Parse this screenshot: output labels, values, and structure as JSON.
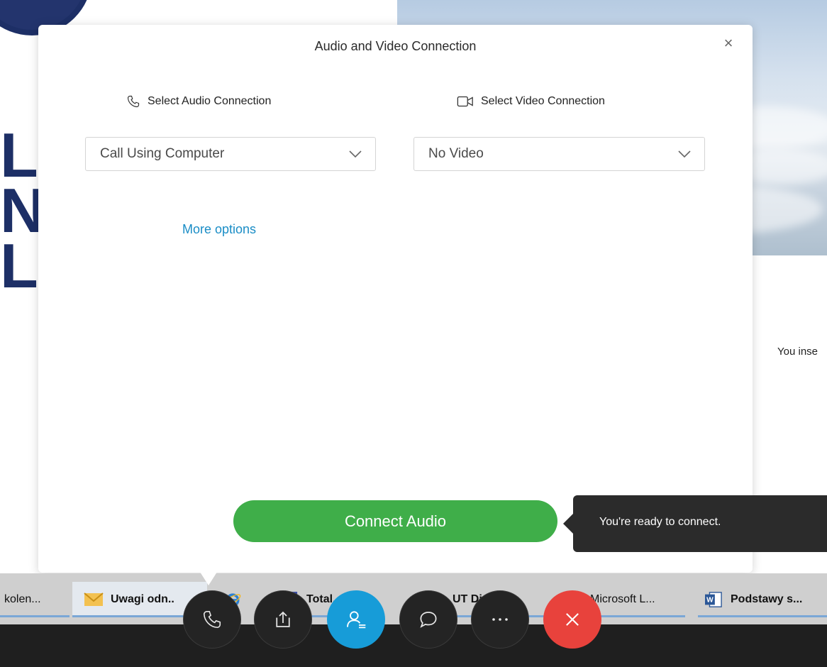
{
  "dialog": {
    "title": "Audio and Video Connection",
    "close_glyph": "×",
    "audio": {
      "label": "Select Audio Connection",
      "icon": "phone-icon",
      "selected": "Call Using Computer"
    },
    "video": {
      "label": "Select Video Connection",
      "icon": "camera-icon",
      "selected": "No Video"
    },
    "more_options": "More options",
    "connect_button": "Connect Audio"
  },
  "tooltip": {
    "text": "You're ready to connect."
  },
  "background": {
    "right_text": "You inse"
  },
  "taskbar": {
    "items": [
      {
        "label": "kolen...",
        "icon": "app-icon"
      },
      {
        "label": "Uwagi odn..",
        "icon": "mail-icon"
      },
      {
        "label": "Total...",
        "icon": "floppy-icon"
      },
      {
        "label": "UT Digital...",
        "icon": "chrome-icon"
      },
      {
        "label": "Microsoft L...",
        "icon": "app-icon"
      },
      {
        "label": "Podstawy s...",
        "icon": "word-icon"
      }
    ]
  },
  "controls": [
    {
      "name": "audio-control-button",
      "icon": "phone-icon"
    },
    {
      "name": "share-control-button",
      "icon": "share-icon"
    },
    {
      "name": "participants-control-button",
      "icon": "participants-icon"
    },
    {
      "name": "chat-control-button",
      "icon": "chat-icon"
    },
    {
      "name": "more-control-button",
      "icon": "more-icon"
    },
    {
      "name": "end-meeting-button",
      "icon": "close-icon"
    }
  ],
  "colors": {
    "connect_green": "#3fae49",
    "link_blue": "#1a8dc6",
    "participants_blue": "#179cd8",
    "end_red": "#e8423c",
    "tooltip_bg": "#2b2b2b"
  }
}
